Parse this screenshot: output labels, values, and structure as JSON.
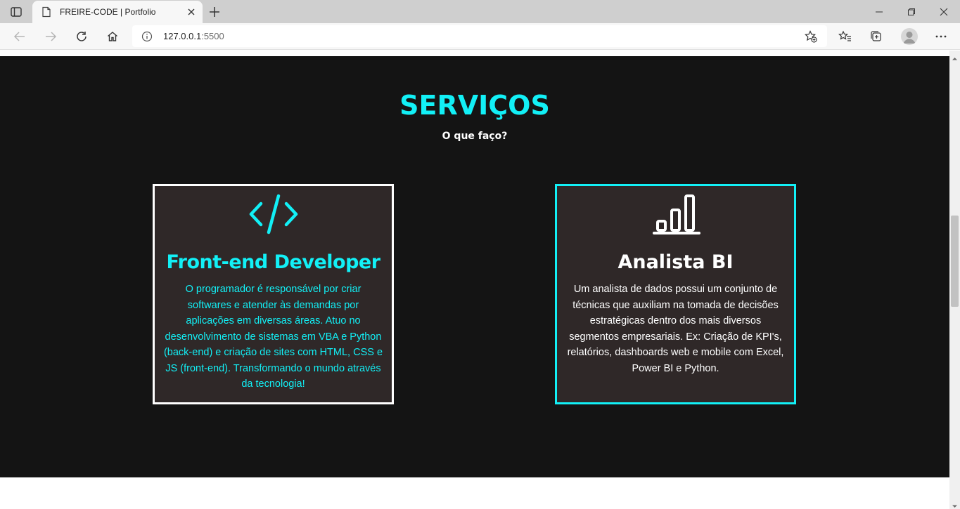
{
  "browser": {
    "tab_title": "FREIRE-CODE | Portfolio",
    "url_host": "127.0.0.1",
    "url_port": ":5500"
  },
  "services": {
    "title": "SERVIÇOS",
    "subtitle": "O que faço?",
    "cards": [
      {
        "icon": "code-icon",
        "title": "Front-end Developer",
        "text": "O programador é responsável por criar softwares e atender às demandas por aplicações em diversas áreas. Atuo no desenvolvimento de sistemas em VBA e Python (back-end) e criação de sites com HTML, CSS e JS (front-end). Transformando o mundo através da tecnologia!"
      },
      {
        "icon": "bar-chart-icon",
        "title": "Analista BI",
        "text": "Um analista de dados possui um conjunto de técnicas que auxiliam na tomada de decisões estratégicas dentro dos mais diversos segmentos empresariais. Ex: Criação de KPI's, relatórios, dashboards web e mobile com Excel, Power BI e Python."
      }
    ]
  },
  "colors": {
    "accent": "#12f0f6",
    "section_bg": "#141414",
    "card_bg": "#2f2828"
  }
}
